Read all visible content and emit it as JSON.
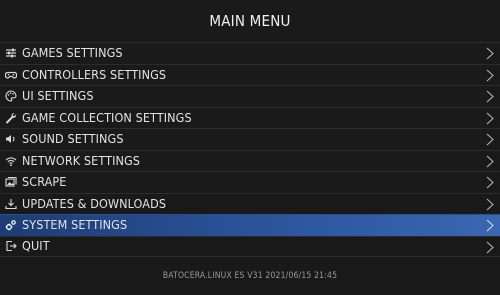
{
  "header": {
    "title": "MAIN MENU"
  },
  "menu": {
    "items": [
      {
        "label": "GAMES SETTINGS",
        "icon": "sliders-icon"
      },
      {
        "label": "CONTROLLERS SETTINGS",
        "icon": "gamepad-icon"
      },
      {
        "label": "UI SETTINGS",
        "icon": "palette-icon"
      },
      {
        "label": "GAME COLLECTION SETTINGS",
        "icon": "wrench-icon"
      },
      {
        "label": "SOUND SETTINGS",
        "icon": "speaker-icon"
      },
      {
        "label": "NETWORK SETTINGS",
        "icon": "wifi-icon"
      },
      {
        "label": "SCRAPE",
        "icon": "images-icon"
      },
      {
        "label": "UPDATES & DOWNLOADS",
        "icon": "download-icon"
      },
      {
        "label": "SYSTEM SETTINGS",
        "icon": "gears-icon",
        "selected": true
      },
      {
        "label": "QUIT",
        "icon": "exit-icon"
      }
    ]
  },
  "footer": {
    "version": "BATOCERA.LINUX ES V31 2021/06/15 21:45"
  },
  "colors": {
    "background": "#191919",
    "selected": "#2a5399",
    "text": "#e3e3e3"
  }
}
